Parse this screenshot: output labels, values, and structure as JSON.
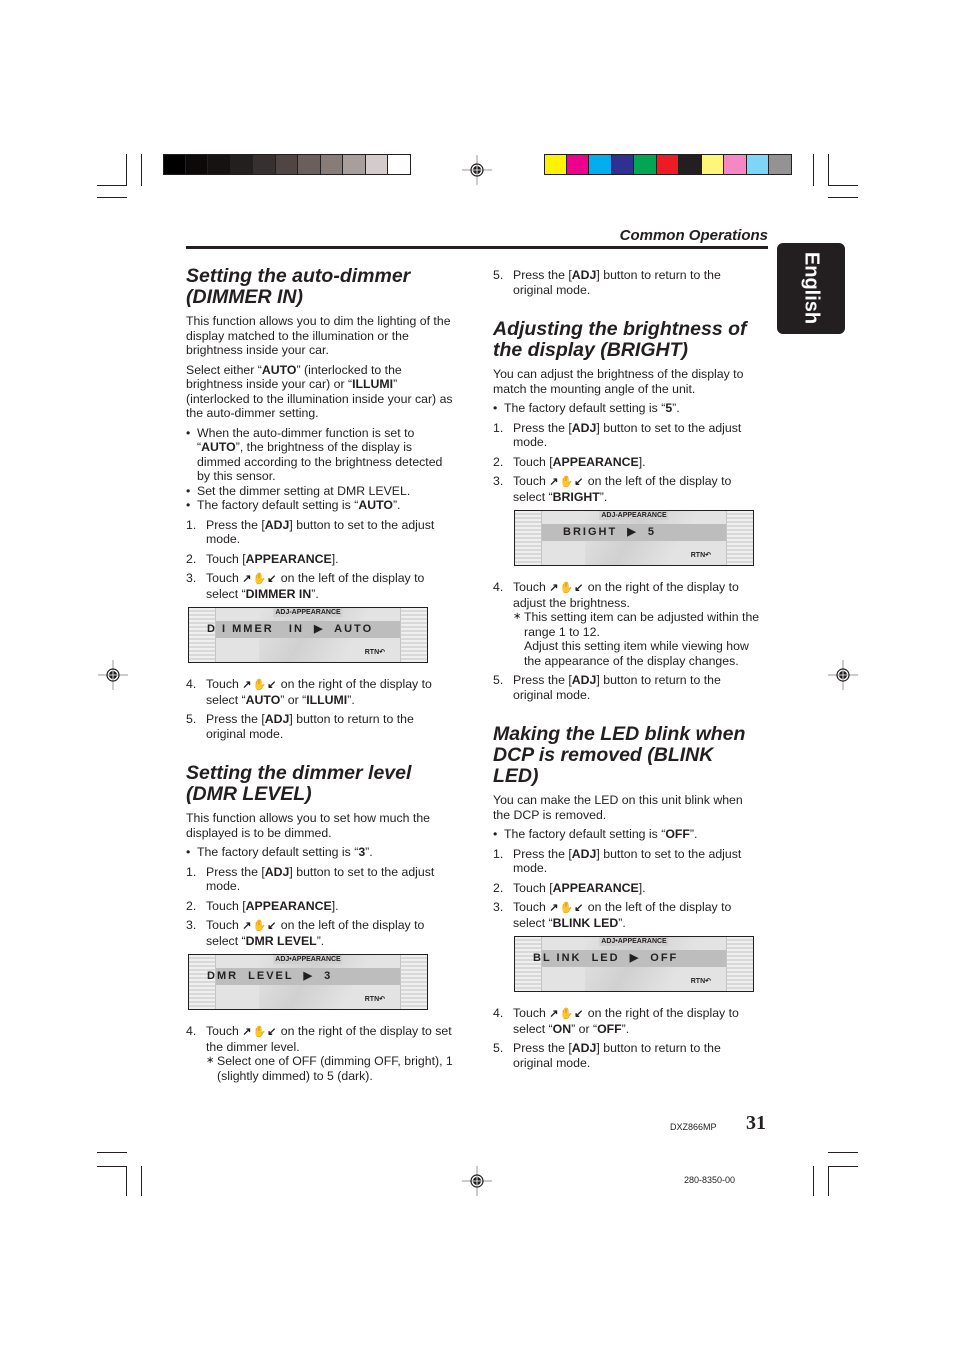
{
  "header": {
    "section_title": "Common Operations",
    "language_tab": "English"
  },
  "print_marks": {
    "grayscale_swatches": [
      "#000000",
      "#0b0a09",
      "#151312",
      "#231f1e",
      "#36302e",
      "#4f4643",
      "#6a5f5c",
      "#887c79",
      "#a89e9b",
      "#d4cccb",
      "#ffffff"
    ],
    "color_swatches": [
      "#fff200",
      "#ec008c",
      "#00aeef",
      "#2e3192",
      "#00a651",
      "#ed1c24",
      "#231f20",
      "#fff57a",
      "#f587c4",
      "#7dd6f7",
      "#939393"
    ]
  },
  "sections": {
    "dimmer_in": {
      "heading": "Setting the auto-dimmer (DIMMER IN)",
      "intro": "This function allows you to dim the lighting of the display matched to the illumination or the brightness inside your car.",
      "select_pre": "Select either “",
      "select_auto": "AUTO",
      "select_mid": "” (interlocked to the brightness inside your car) or “",
      "select_illumi": "ILLUMI",
      "select_post": "” (interlocked to the illumination inside your car) as the auto-dimmer setting.",
      "bullet1_pre": "When the auto-dimmer function is set to “",
      "bullet1_bold": "AUTO",
      "bullet1_post": "”, the brightness of the display is dimmed according to the brightness detected by this sensor.",
      "bullet2": "Set the dimmer setting at DMR LEVEL.",
      "bullet3_pre": "The factory default setting is “",
      "bullet3_bold": "AUTO",
      "bullet3_post": "”.",
      "step3_target": "DIMMER IN",
      "step4_pre": " on the right of the display to select “",
      "step4_a": "AUTO",
      "step4_mid": "” or “",
      "step4_b": "ILLUMI",
      "step4_post": "”.",
      "lcd": {
        "title": "ADJ-APPEARANCE",
        "text": "D I MMER   IN  ▶  AUTO",
        "rtn": "RTN↶"
      }
    },
    "dmr_level": {
      "heading": "Setting the dimmer level (DMR LEVEL)",
      "intro": "This function allows you to set how much the displayed is to be dimmed.",
      "bullet_pre": "The factory default setting is “",
      "bullet_bold": "3",
      "bullet_post": "”.",
      "step3_target": "DMR LEVEL",
      "step4_text": " on the right of the display to set the dimmer level.",
      "step4_note": "Select one of OFF (dimming OFF, bright), 1 (slightly dimmed) to 5 (dark).",
      "lcd": {
        "title": "ADJ•APPEARANCE",
        "text": "DMR  LEVEL  ▶  3",
        "rtn": "RTN↶"
      }
    },
    "bright": {
      "heading": "Adjusting the brightness of the display (BRIGHT)",
      "intro": "You can adjust the brightness of the display to match the mounting angle of the unit.",
      "bullet_pre": "The factory default setting is “",
      "bullet_bold": "5",
      "bullet_post": "”.",
      "step3_target": "BRIGHT",
      "step4_text": " on the right of the display to adjust the brightness.",
      "step4_note1": "This setting item can be adjusted within the range 1 to 12.",
      "step4_note2": "Adjust this setting item while viewing how the appearance of the display changes.",
      "lcd": {
        "title": "ADJ-APPEARANCE",
        "text": "BRIGHT  ▶  5",
        "rtn": "RTN↶"
      }
    },
    "blink_led": {
      "heading": "Making the LED blink when DCP is removed (BLINK LED)",
      "intro": "You can make the LED on this unit blink when the DCP is removed.",
      "bullet_pre": "The factory default setting is “",
      "bullet_bold": "OFF",
      "bullet_post": "”.",
      "step3_target": "BLINK LED",
      "step4_pre": " on the right of the display to select “",
      "step4_a": "ON",
      "step4_mid": "” or “",
      "step4_b": "OFF",
      "step4_post": "”.",
      "lcd": {
        "title": "ADJ•APPEARANCE",
        "text": "BL INK  LED  ▶  OFF",
        "rtn": "RTN↶"
      }
    }
  },
  "common_steps": {
    "n1": "1.",
    "n2": "2.",
    "n3": "3.",
    "n4": "4.",
    "n5": "5.",
    "step1_pre": "Press the [",
    "adj": "ADJ",
    "step1_post": "] button to set to the adjust mode.",
    "step2_pre": "Touch [",
    "appearance": "APPEARANCE",
    "step2_post": "].",
    "touch": "Touch ",
    "arrow_icons": "↗✋↙",
    "step3_mid": " on the left of the display to select “",
    "step3_post": "”.",
    "step5_pre": "Press the [",
    "step5_post": "] button to return to the original mode.",
    "asterisk": "∗"
  },
  "footer": {
    "model": "DXZ866MP",
    "page_number": "31",
    "part_number": "280-8350-00"
  }
}
